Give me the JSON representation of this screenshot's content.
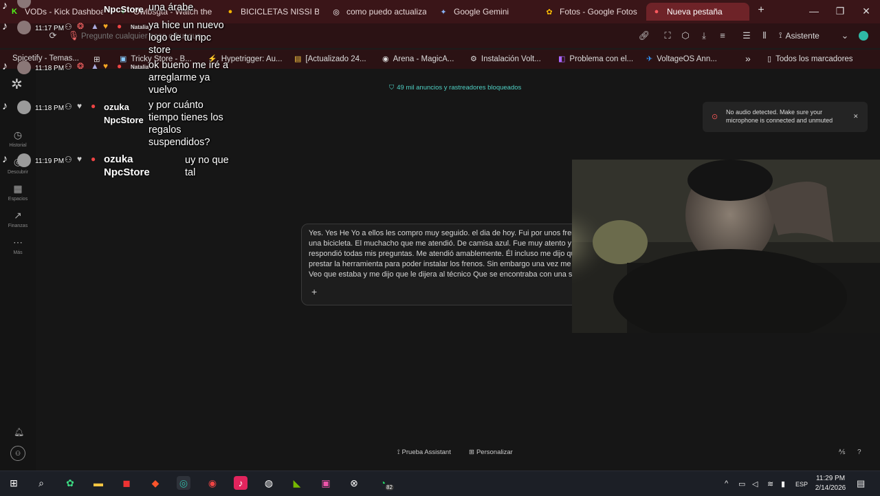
{
  "tabs": [
    {
      "label": "VODs - Kick Dashboard",
      "fav": "K",
      "color": "#53fc18"
    },
    {
      "label": "Owlbsgta - Watch the",
      "fav": "✦",
      "color": "#2ea44f"
    },
    {
      "label": "BICICLETAS NISSI BIK",
      "fav": "●",
      "color": "#f4b400"
    },
    {
      "label": "como puedo actualiza",
      "fav": "◎",
      "color": "#ffffff"
    },
    {
      "label": "Google Gemini",
      "fav": "✦",
      "color": "#8ab4f8"
    },
    {
      "label": "Fotos - Google Fotos",
      "fav": "✿",
      "color": "#fbbc04"
    },
    {
      "label": "Nueva pestaña",
      "fav": "●",
      "color": "#ff5a5f"
    }
  ],
  "tab_new": "+",
  "window": {
    "minimize": "—",
    "maximize": "❐",
    "close": "✕"
  },
  "address": {
    "placeholder": "Pregunte cualquier cosa o busque"
  },
  "toolbar": {
    "assistant_label": "Asistente"
  },
  "bookmarks": [
    {
      "label": "Spicetify - Temas...",
      "icon": "♪"
    },
    {
      "label": "Tricky Store - B...",
      "icon": "▣"
    },
    {
      "label": "Hypetrigger: Au...",
      "icon": "⚡"
    },
    {
      "label": "[Actualizado 24...",
      "icon": "▤"
    },
    {
      "label": "Arena - MagicA...",
      "icon": "◉"
    },
    {
      "label": "Instalación Volt...",
      "icon": "⚙"
    },
    {
      "label": "Problema con el...",
      "icon": "◧"
    },
    {
      "label": "VoltageOS Ann...",
      "icon": "✈"
    }
  ],
  "bookmarks_more": "»",
  "bookmarks_all": "Todos los marcadores",
  "sidebar": [
    {
      "label": "Historial",
      "icon": "◷"
    },
    {
      "label": "Descubrir",
      "icon": "◎"
    },
    {
      "label": "Espacios",
      "icon": "▦"
    },
    {
      "label": "Finanzas",
      "icon": "↗"
    },
    {
      "label": "Más",
      "icon": "⋯"
    }
  ],
  "ads_blocked": "49 mil anuncios y rastreadores bloqueados",
  "notice": {
    "text": "No audio detected. Make sure your microphone is connected and unmuted",
    "close": "✕"
  },
  "chat": [
    {
      "time": "11:17 PM",
      "user": "NpcStore",
      "badge_user": "Natalia",
      "lines": [
        "una árabe",
        "ya hice un nuevo",
        "logo de tu npc",
        "store"
      ]
    },
    {
      "time": "11:18 PM",
      "badge_user": "Natalia",
      "lines": [
        "ok bueno me iré a",
        "arreglarme ya",
        "vuelvo"
      ]
    },
    {
      "time": "11:18 PM",
      "user_line1": "ozuka",
      "user_line2": "NpcStore",
      "lines": [
        "y por cuánto",
        "tiempo tienes los",
        "regalos",
        "suspendidos?"
      ]
    },
    {
      "time": "11:19 PM",
      "user_line1": "ozuka",
      "user_line2": "NpcStore",
      "lines": [
        "uy no que",
        "tal"
      ]
    }
  ],
  "input": {
    "lines": [
      "Yes. Yes He Yo a ellos les compro muy seguido. el dia de hoy. Fui por unos frenos. P",
      "una bicicleta. El muchacho que me atendió. De camisa azul. Fue muy atento y me",
      "respondió todas mis preguntas. Me atendió amablemente. Él incluso me dijo que m",
      "prestar la herramienta para poder instalar los frenos. Sin embargo una vez me los v",
      "Veo que estaba y me dijo que le dijera al   técnico Que se encontraba con una seño"
    ],
    "plus": "+"
  },
  "footer": {
    "assistant_test": "Prueba Assistant",
    "customize": "Personalizar"
  },
  "taskbar": {
    "time": "11:29 PM",
    "date": "2/14/2026",
    "lang": "ESP",
    "whatsapp_badge": "82"
  },
  "colors": {
    "tab_bg": "#3a1518",
    "toolbar_bg": "#2b1214",
    "active_tab": "#6e2328",
    "shield": "#4fd1c5"
  }
}
